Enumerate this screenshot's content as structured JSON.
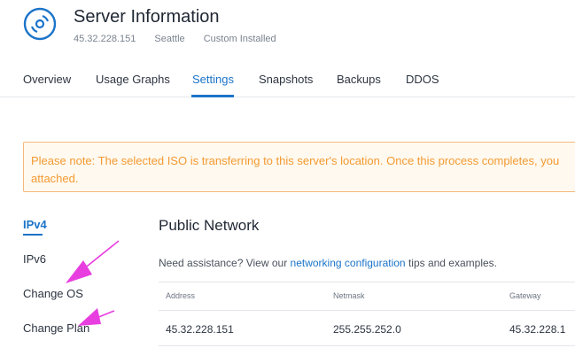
{
  "header": {
    "title": "Server Information",
    "ip": "45.32.228.151",
    "location": "Seattle",
    "status": "Custom Installed",
    "icon": "server-disc-icon"
  },
  "tabs": [
    {
      "label": "Overview"
    },
    {
      "label": "Usage Graphs"
    },
    {
      "label": "Settings",
      "active": true
    },
    {
      "label": "Snapshots"
    },
    {
      "label": "Backups"
    },
    {
      "label": "DDOS"
    }
  ],
  "notice": {
    "text": "Please note: The selected ISO is transferring to this server's location. Once this process completes, you attached."
  },
  "sidebar": {
    "items": [
      {
        "label": "IPv4",
        "active": true
      },
      {
        "label": "IPv6"
      },
      {
        "label": "Change OS"
      },
      {
        "label": "Change Plan"
      }
    ]
  },
  "main": {
    "section_title": "Public Network",
    "assist_prefix": "Need assistance? View our ",
    "assist_link": "networking configuration",
    "assist_suffix": " tips and examples.",
    "table": {
      "headers": [
        "Address",
        "Netmask",
        "Gateway"
      ],
      "rows": [
        [
          "45.32.228.151",
          "255.255.252.0",
          "45.32.228.1"
        ]
      ]
    }
  },
  "colors": {
    "accent": "#1b74c9",
    "notice_border": "#f4b87a",
    "notice_text": "#f39a32",
    "annotation_arrow": "#e83ee0"
  }
}
